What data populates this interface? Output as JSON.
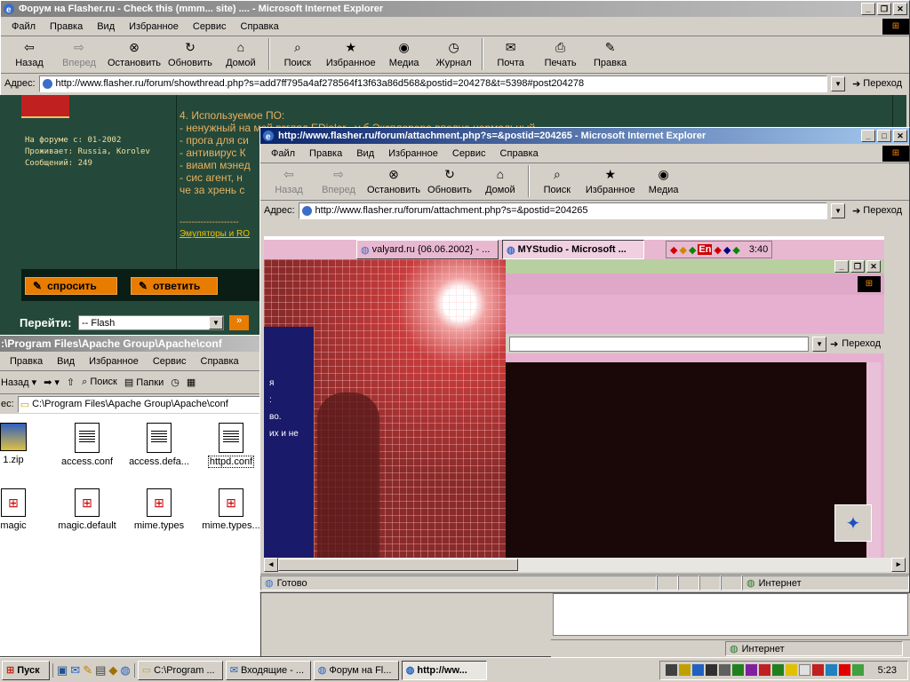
{
  "bg_window": {
    "title": "Форум на Flasher.ru - Check this (mmm... site) .... - Microsoft Internet Explorer",
    "menu": [
      "Файл",
      "Правка",
      "Вид",
      "Избранное",
      "Сервис",
      "Справка"
    ],
    "toolbar": [
      "Назад",
      "Вперед",
      "Остановить",
      "Обновить",
      "Домой",
      "Поиск",
      "Избранное",
      "Медиа",
      "Журнал",
      "Почта",
      "Печать",
      "Правка"
    ],
    "address_label": "Адрес:",
    "address": "http://www.flasher.ru/forum/showthread.php?s=add7ff795a4af278564f13f63a86d568&postid=204278&t=5398#post204278",
    "go": "Переход",
    "status_zone": "Интернет"
  },
  "forum": {
    "user_since": "На форуме с: 01-2002",
    "user_location": "Проживает: Russia, Korolev",
    "user_posts": "Сообщений: 249",
    "post_lines": [
      "4. Используемое ПО:",
      "- ненужный на мой взгляд EDialer , у б Эксплорера вполне нормальный",
      "- прога для си",
      "- антивирус К",
      "- виамп мэнед",
      "- сис агент, н",
      "че за хрень с"
    ],
    "sig_dashes": "--------------------",
    "sig_link": "Эмуляторы и RO",
    "ask_button": "спросить",
    "reply_button": "ответить",
    "goto_label": "Перейти:",
    "goto_value": "-- Flash",
    "goto_btn": "»"
  },
  "explorer": {
    "title": ":\\Program Files\\Apache Group\\Apache\\conf",
    "menu": [
      "Правка",
      "Вид",
      "Избранное",
      "Сервис",
      "Справка"
    ],
    "back": "Назад",
    "search": "Поиск",
    "folders": "Папки",
    "address_label": "ес:",
    "address": "C:\\Program Files\\Apache Group\\Apache\\conf",
    "files": [
      "1.zip",
      "access.conf",
      "access.defa...",
      "httpd.conf",
      "magic",
      "magic.default",
      "mime.types",
      "mime.types..."
    ]
  },
  "fg_window": {
    "title": "http://www.flasher.ru/forum/attachment.php?s=&postid=204265 - Microsoft Internet Explorer",
    "menu": [
      "Файл",
      "Правка",
      "Вид",
      "Избранное",
      "Сервис",
      "Справка"
    ],
    "toolbar": [
      "Назад",
      "Вперед",
      "Остановить",
      "Обновить",
      "Домой",
      "Поиск",
      "Избранное",
      "Медиа"
    ],
    "address_label": "Адрес:",
    "address": "http://www.flasher.ru/forum/attachment.php?s=&postid=204265",
    "go": "Переход",
    "status_done": "Готово",
    "status_zone": "Интернет"
  },
  "inner": {
    "tasks": [
      "valyard.ru {06.06.2002} - ...",
      "MYStudio - Microsoft ..."
    ],
    "clock": "3:40",
    "lang": "En",
    "go": "Переход",
    "text_frag": [
      "я",
      ":",
      "во.",
      "их и не"
    ]
  },
  "taskbar": {
    "start": "Пуск",
    "items": [
      "C:\\Program ...",
      "Входящие - ...",
      "Форум на Fl...",
      "http://ww..."
    ],
    "clock": "5:23"
  }
}
